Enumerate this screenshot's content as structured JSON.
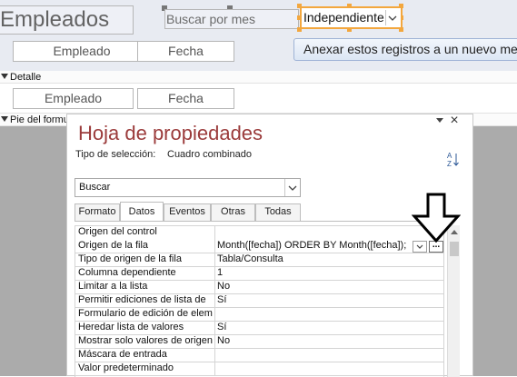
{
  "form": {
    "header_title": "Empleados",
    "search_label": "Buscar por mes",
    "search_combo_value": "Independiente",
    "header_column_labels": [
      "Empleado",
      "Fecha"
    ],
    "append_button": "Anexar estos registros a un nuevo mes",
    "detail_band": "Detalle",
    "detail_fields": [
      "Empleado",
      "Fecha"
    ],
    "footer_band": "Pie del formulario"
  },
  "sheet": {
    "title": "Hoja de propiedades",
    "selection_type_label": "Tipo de selección:",
    "selection_type_value": "Cuadro combinado",
    "object_selected": "Buscar",
    "tabs": [
      "Formato",
      "Datos",
      "Eventos",
      "Otras",
      "Todas"
    ],
    "active_tab": "Datos",
    "properties": [
      {
        "name": "Origen del control",
        "value": ""
      },
      {
        "name": "Origen de la fila",
        "value": "Month([fecha]) ORDER BY Month([fecha]);"
      },
      {
        "name": "Tipo de origen de la fila",
        "value": "Tabla/Consulta"
      },
      {
        "name": "Columna dependiente",
        "value": "1"
      },
      {
        "name": "Limitar a la lista",
        "value": "No"
      },
      {
        "name": "Permitir ediciones de lista de",
        "value": "Sí"
      },
      {
        "name": "Formulario de edición de elementos",
        "value": ""
      },
      {
        "name": "Heredar lista de valores",
        "value": "Sí"
      },
      {
        "name": "Mostrar solo valores de origen",
        "value": "No"
      },
      {
        "name": "Máscara de entrada",
        "value": ""
      },
      {
        "name": "Valor predeterminado",
        "value": ""
      }
    ],
    "build_button": "...",
    "close_icon": "×",
    "sort_icon": "A↓Z"
  },
  "colors": {
    "accent_selection": "#f3a73e",
    "sheet_title": "#9b3b3b"
  }
}
